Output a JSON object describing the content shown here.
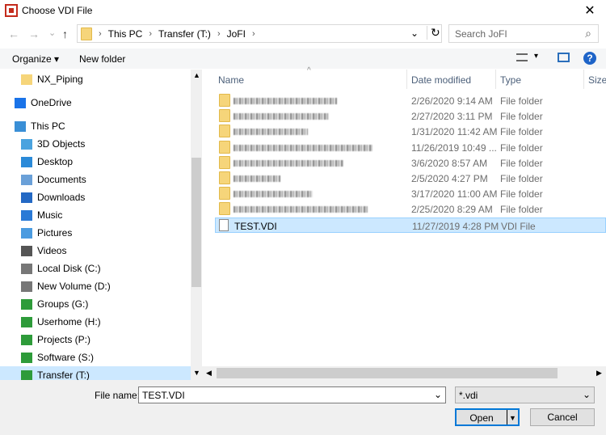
{
  "window": {
    "title": "Choose VDI File",
    "close": "✕"
  },
  "nav": {
    "back": "←",
    "forward": "→",
    "recent": "⌄",
    "up": "↑"
  },
  "address": {
    "crumbs": [
      "This PC",
      "Transfer (T:)",
      "JoFI"
    ],
    "sep": "›",
    "dropdown": "⌄",
    "refresh": "↻"
  },
  "search": {
    "placeholder": "Search JoFI",
    "icon": "⌕"
  },
  "toolbar": {
    "organize": "Organize ▾",
    "new_folder": "New folder",
    "help": "?"
  },
  "navpane": {
    "items": [
      {
        "label": "NX_Piping",
        "icon": "folder"
      },
      {
        "label": "OneDrive",
        "icon": "cloud"
      },
      {
        "label": "This PC",
        "icon": "computer"
      },
      {
        "label": "3D Objects",
        "icon": "cube"
      },
      {
        "label": "Desktop",
        "icon": "desktop"
      },
      {
        "label": "Documents",
        "icon": "document"
      },
      {
        "label": "Downloads",
        "icon": "download"
      },
      {
        "label": "Music",
        "icon": "music"
      },
      {
        "label": "Pictures",
        "icon": "picture"
      },
      {
        "label": "Videos",
        "icon": "video"
      },
      {
        "label": "Local Disk (C:)",
        "icon": "drive"
      },
      {
        "label": "New Volume (D:)",
        "icon": "drive"
      },
      {
        "label": "Groups (G:)",
        "icon": "network-drive"
      },
      {
        "label": "Userhome (H:)",
        "icon": "network-drive"
      },
      {
        "label": "Projects (P:)",
        "icon": "network-drive"
      },
      {
        "label": "Software (S:)",
        "icon": "network-drive"
      },
      {
        "label": "Transfer (T:)",
        "icon": "network-drive"
      }
    ]
  },
  "columns": {
    "name": "Name",
    "date": "Date modified",
    "type": "Type",
    "size": "Size"
  },
  "files": [
    {
      "date": "2/26/2020 9:14 AM",
      "type": "File folder"
    },
    {
      "date": "2/27/2020 3:11 PM",
      "type": "File folder"
    },
    {
      "date": "1/31/2020 11:42 AM",
      "type": "File folder"
    },
    {
      "date": "11/26/2019 10:49 ...",
      "type": "File folder"
    },
    {
      "date": "3/6/2020 8:57 AM",
      "type": "File folder"
    },
    {
      "date": "2/5/2020 4:27 PM",
      "type": "File folder"
    },
    {
      "date": "3/17/2020 11:00 AM",
      "type": "File folder"
    },
    {
      "date": "2/25/2020 8:29 AM",
      "type": "File folder"
    },
    {
      "name": "TEST.VDI",
      "date": "11/27/2019 4:28 PM",
      "type": "VDI File"
    }
  ],
  "bottom": {
    "file_name_label": "File name:",
    "file_name_value": "TEST.VDI",
    "file_type": "*.vdi",
    "open": "Open",
    "cancel": "Cancel"
  }
}
